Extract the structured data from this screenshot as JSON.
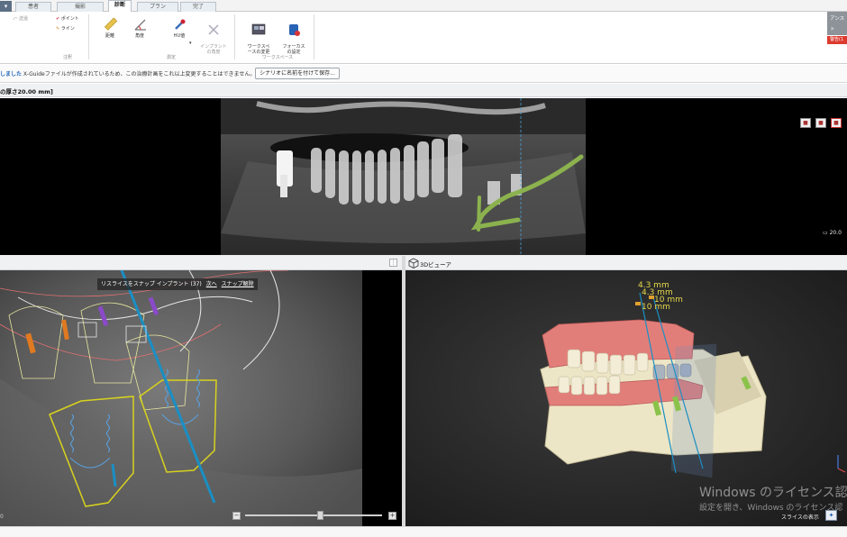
{
  "tabs": [
    "患者",
    "撮影",
    "診断",
    "プラン",
    "完了"
  ],
  "ribbon": {
    "undo": "送還",
    "point": "ポイント",
    "line": "ライン",
    "annotation_group": "注釈",
    "distance": "距離",
    "angle": "角度",
    "hu_value": "HU値",
    "implant_angle": "インプラント\nの角度",
    "measure_group": "測定",
    "workspace_change": "ワークスペ\nースの変更",
    "focus_setting": "フォーカス\nの設定",
    "workspace_group": "ワークスペース",
    "side_btn1": "アンスト",
    "side_btn2": "警告(1"
  },
  "infobar": {
    "prefix": "しました",
    "message": " X-Guideファイルが作成されているため、この治療計画をこれ以上変更することはできません。",
    "save_button": "シナリオに名前を付けて保存..."
  },
  "pano": {
    "title": "の厚さ20.00 mm]",
    "thickness": "20.0"
  },
  "cross": {
    "snap_text": "リスライスをスナップ インプラント (37)",
    "next_link": "次へ",
    "release_link": "スナップ解除",
    "zero": "0"
  },
  "viewer3d": {
    "title": "3Dビューア",
    "measures": [
      "4.3 mm",
      "4.3 mm",
      "10 mm",
      "10 mm"
    ],
    "slice_show": "スライスの表示",
    "wm1": "Windows のライセンス認証",
    "wm2": "設定を開き、Windows のライセンス認"
  },
  "colors": {
    "implant_yellow": "#d8d21e",
    "axis_blue": "#1a8fc4",
    "nerve_green": "#8bb24e",
    "alert_red": "#dd3b2f",
    "gum_pink": "#e27e7a",
    "bone_ivory": "#ede6c6"
  }
}
